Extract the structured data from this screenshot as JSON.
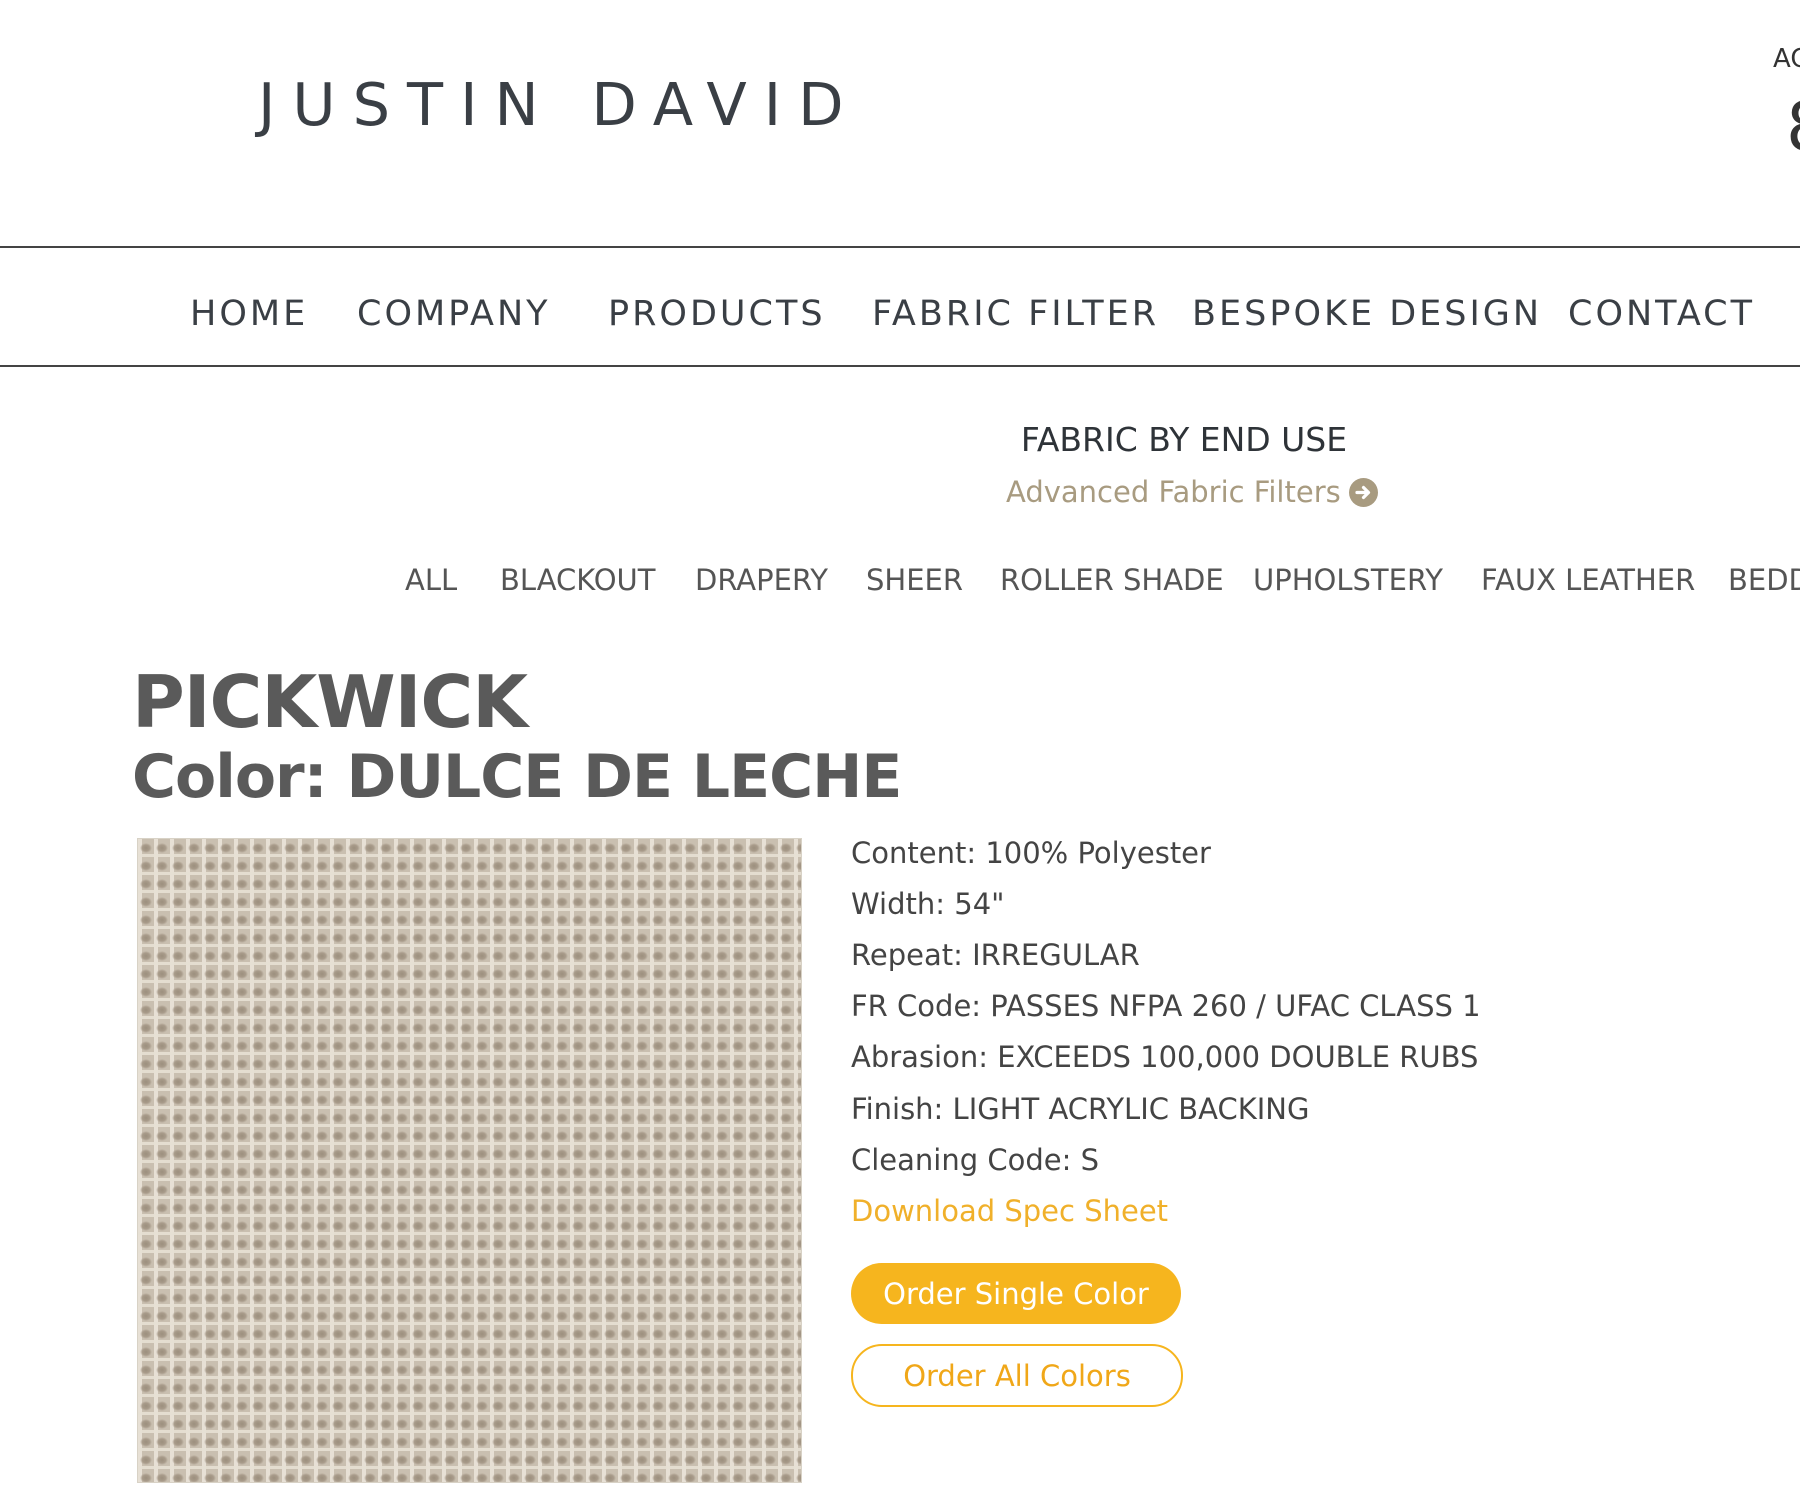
{
  "header": {
    "logo_text": "JUSTIN DAVID",
    "cut_label": "AC",
    "cut_digit": "8"
  },
  "nav": {
    "items": [
      "HOME",
      "COMPANY",
      "PRODUCTS",
      "FABRIC FILTER",
      "BESPOKE DESIGN",
      "CONTACT"
    ]
  },
  "fabric_section": {
    "title": "FABRIC BY END USE",
    "advanced_link": "Advanced Fabric Filters",
    "advanced_icon": "arrow-circle-right-icon",
    "categories": [
      "ALL",
      "BLACKOUT",
      "DRAPERY",
      "SHEER",
      "ROLLER SHADE",
      "UPHOLSTERY",
      "FAUX LEATHER",
      "BEDD"
    ]
  },
  "product": {
    "name": "PICKWICK",
    "color_line": "Color: DULCE DE LECHE",
    "specs": {
      "content": "Content: 100% Polyester",
      "width": "Width: 54\"",
      "repeat": "Repeat: IRREGULAR",
      "fr_code": "FR Code: PASSES NFPA 260 / UFAC CLASS 1",
      "abrasion": "Abrasion: EXCEEDS 100,000 DOUBLE RUBS",
      "finish": "Finish: LIGHT ACRYLIC BACKING",
      "cleaning": "Cleaning Code: S"
    },
    "download_link": "Download Spec Sheet",
    "order_single": "Order Single Color",
    "order_all": "Order All Colors"
  },
  "colors": {
    "accent": "#f6b51e",
    "link_gold": "#a89b80",
    "text_dark": "#3a3f45",
    "swatch": "#c9bfb0"
  }
}
